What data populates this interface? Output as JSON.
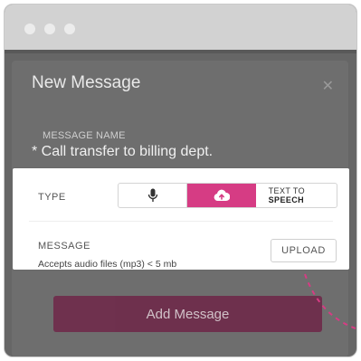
{
  "window": {
    "controls": [
      "close",
      "minimize",
      "maximize"
    ]
  },
  "modal": {
    "title": "New Message",
    "close_icon": "close-icon",
    "message_name_label": "MESSAGE NAME",
    "message_name_value": "* Call transfer to billing dept.",
    "type": {
      "label": "TYPE",
      "options": [
        {
          "id": "record",
          "icon": "microphone-icon",
          "selected": false
        },
        {
          "id": "upload",
          "icon": "cloud-upload-icon",
          "selected": true
        },
        {
          "id": "tts",
          "label_top": "TEXT TO",
          "label_bottom": "SPEECH",
          "selected": false
        }
      ]
    },
    "message": {
      "label": "MESSAGE",
      "hint": "Accepts audio files (mp3) < 5 mb",
      "upload_label": "UPLOAD"
    },
    "submit_label": "Add Message"
  },
  "colors": {
    "accent": "#d63c84",
    "submit_bg": "#6f2a4a",
    "overlay": "#666666",
    "titlebar": "#d2d2d2"
  }
}
